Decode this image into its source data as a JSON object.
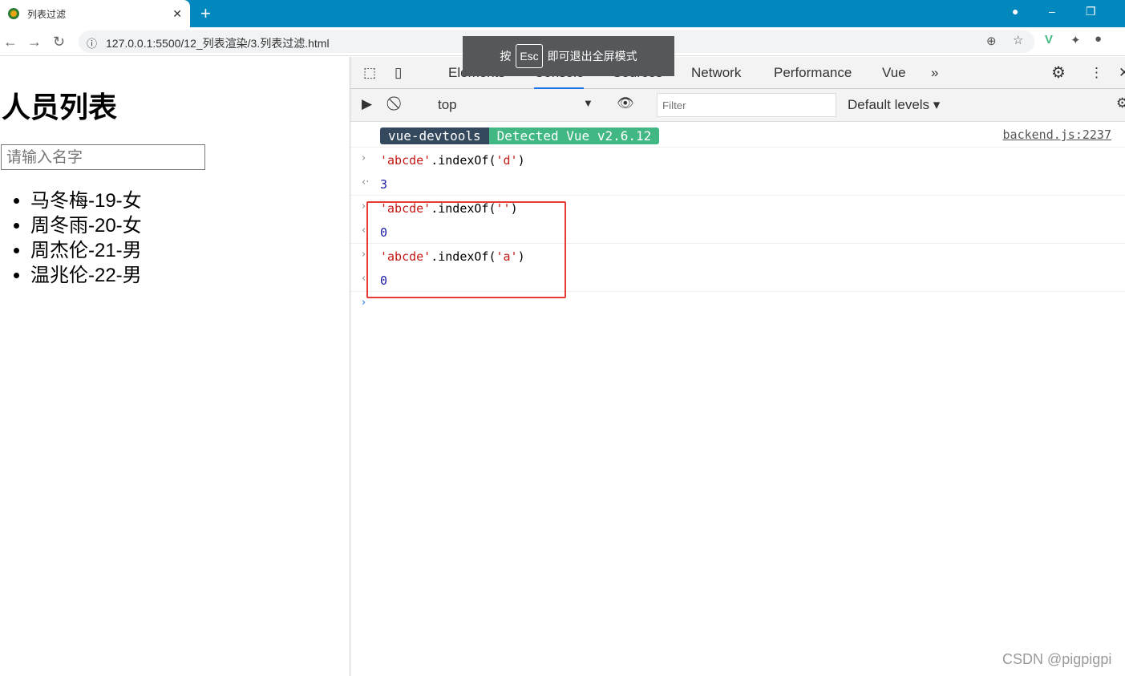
{
  "browser": {
    "tab_title": "列表过滤",
    "url": "127.0.0.1:5500/12_列表渲染/3.列表过滤.html"
  },
  "toast": {
    "pre": "按",
    "key": "Esc",
    "post": "即可退出全屏模式"
  },
  "page": {
    "title": "人员列表",
    "search_placeholder": "请输入名字",
    "persons": [
      "马冬梅-19-女",
      "周冬雨-20-女",
      "周杰伦-21-男",
      "温兆伦-22-男"
    ]
  },
  "devtools": {
    "tabs": [
      "Elements",
      "Console",
      "Sources",
      "Network",
      "Performance",
      "Vue"
    ],
    "active_tab": "Console",
    "context": "top",
    "filter_placeholder": "Filter",
    "levels": "Default levels",
    "badge": {
      "left": "vue-devtools",
      "right": "Detected Vue v2.6.12",
      "source": "backend.js:2237"
    },
    "entries": [
      {
        "s": "'abcde'",
        "m": ".indexOf(",
        "a": "'d'",
        "e": ")",
        "result": "3"
      },
      {
        "s": "'abcde'",
        "m": ".indexOf(",
        "a": "''",
        "e": ")",
        "result": "0"
      },
      {
        "s": "'abcde'",
        "m": ".indexOf(",
        "a": "'a'",
        "e": ")",
        "result": "0"
      }
    ]
  },
  "watermark": "CSDN @pigpigpi"
}
